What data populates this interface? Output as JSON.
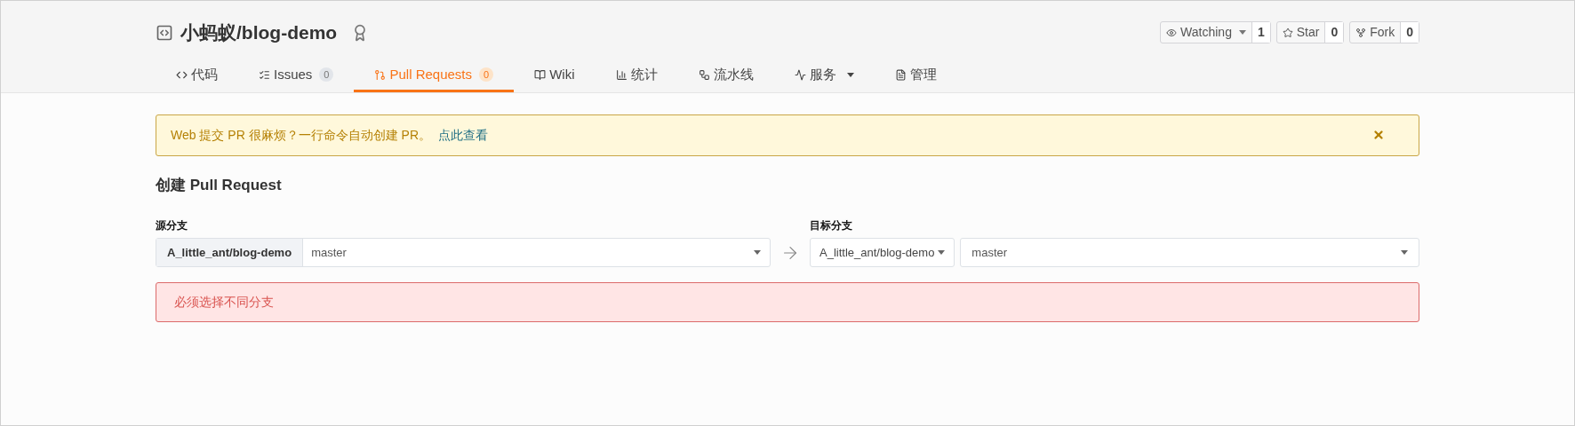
{
  "repo": {
    "title": "小蚂蚁/blog-demo"
  },
  "actions": [
    {
      "label": "Watching",
      "count": "1",
      "dropdown": true
    },
    {
      "label": "Star",
      "count": "0",
      "dropdown": false
    },
    {
      "label": "Fork",
      "count": "0",
      "dropdown": false
    }
  ],
  "tabs": [
    {
      "label": "代码",
      "selected": false
    },
    {
      "label": "Issues",
      "count": "0",
      "selected": false
    },
    {
      "label": "Pull Requests",
      "count": "0",
      "selected": true
    },
    {
      "label": "Wiki",
      "selected": false
    },
    {
      "label": "统计",
      "selected": false
    },
    {
      "label": "流水线",
      "selected": false
    },
    {
      "label": "服务",
      "selected": false,
      "dropdown": true
    },
    {
      "label": "管理",
      "selected": false
    }
  ],
  "notice": {
    "text": "Web 提交 PR 很麻烦？一行命令自动创建 PR。",
    "link": "点此查看"
  },
  "heading": "创建 Pull Request",
  "source": {
    "label": "源分支",
    "repo": "A_little_ant/blog-demo",
    "branch": "master"
  },
  "target": {
    "label": "目标分支",
    "repo": "A_little_ant/blog-demo",
    "branch": "master"
  },
  "error": "必须选择不同分支"
}
